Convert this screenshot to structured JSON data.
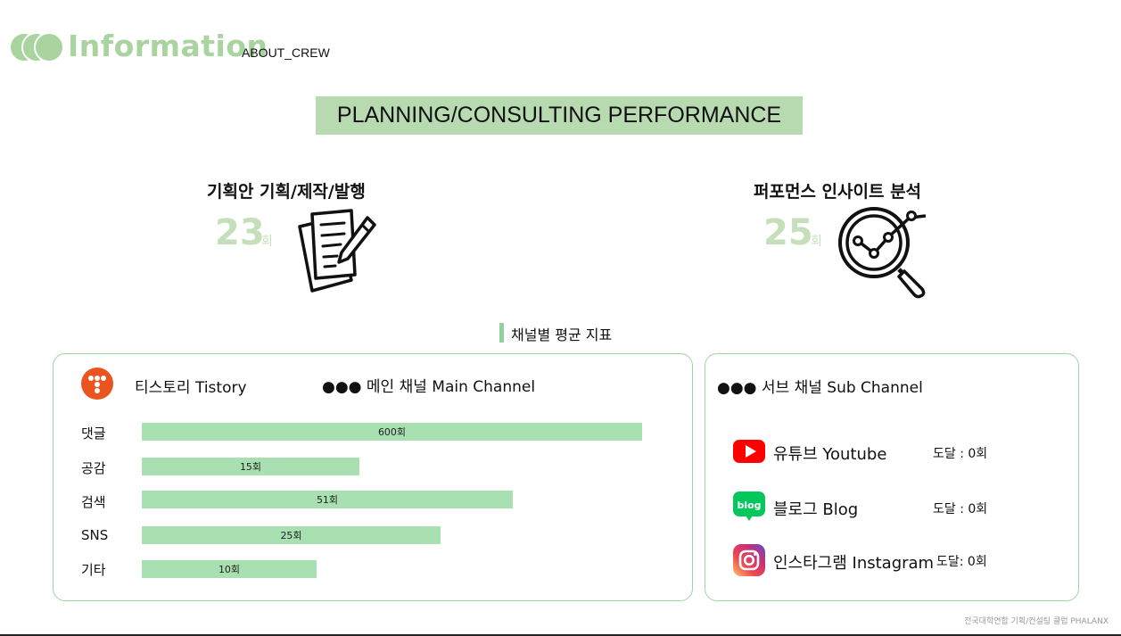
{
  "header": {
    "title": "Information",
    "subtitle": "ABOUT_CREW",
    "accent_color": "#a9d39f"
  },
  "banner": {
    "text": "PLANNING/CONSULTING PERFORMANCE",
    "background": "#b7dab0"
  },
  "stats": [
    {
      "title": "기획안 기획/제작/발행",
      "value": "23",
      "unit": "회",
      "icon": "document-pencil-icon"
    },
    {
      "title": "퍼포먼스 인사이트 분석",
      "value": "25",
      "unit": "회",
      "icon": "magnifier-chart-icon"
    }
  ],
  "section_label": "채널별 평균 지표",
  "main_panel": {
    "platform": "티스토리 Tistory",
    "channel_label": "●●● 메인 채널 Main  Channel",
    "metrics": [
      {
        "label": "댓글",
        "value": 600,
        "display": "600회"
      },
      {
        "label": "공감",
        "value": 15,
        "display": "15회"
      },
      {
        "label": "검색",
        "value": 51,
        "display": "51회"
      },
      {
        "label": "SNS",
        "value": 25,
        "display": "25회"
      },
      {
        "label": "기타",
        "value": 10,
        "display": "10회"
      }
    ],
    "bar_fill_fractions": [
      1.0,
      0.435,
      0.742,
      0.597,
      0.349
    ],
    "bar_color": "#a8e0b1"
  },
  "sub_panel": {
    "channel_label": "●●● 서브 채널 Sub  Channel",
    "channels": [
      {
        "name": "유튜브 Youtube",
        "reach": "도달 : 0회",
        "icon": "youtube-icon"
      },
      {
        "name": "블로그 Blog",
        "reach": "도달 : 0회",
        "icon": "blog-icon"
      },
      {
        "name": "인스타그램 Instagram",
        "reach": "도달: 0회",
        "icon": "instagram-icon"
      }
    ]
  },
  "footer": {
    "text": "전국대학연합 기획/컨설팅 클럽 PHALANX"
  }
}
